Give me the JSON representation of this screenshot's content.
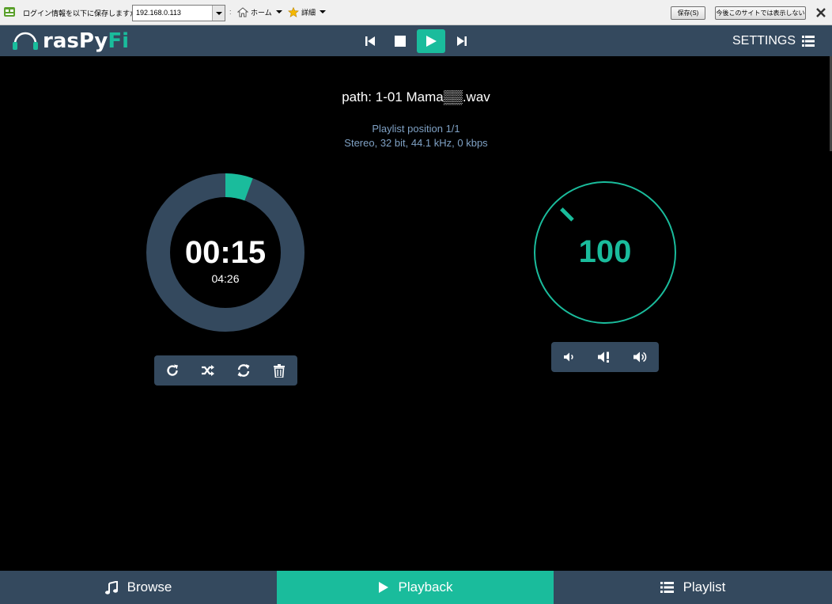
{
  "browser_bar": {
    "prompt": "ログイン情報を以下に保存しますか:",
    "address": "192.168.0.113",
    "separator": ":",
    "home_label": "ホーム",
    "details_label": "詳細",
    "save_button": "保存(S)",
    "never_button": "今後このサイトでは表示しない"
  },
  "header": {
    "logo_text_a": "rasPy",
    "logo_text_b": "Fi",
    "settings_label": "SETTINGS"
  },
  "track": {
    "path": "path: 1-01 Mama▒▒.wav",
    "playlist_position": "Playlist position 1/1",
    "format": "Stereo, 32 bit, 44.1 kHz, 0 kbps"
  },
  "playback": {
    "elapsed": "00:15",
    "total": "04:26",
    "progress_fraction": 0.0564
  },
  "volume": {
    "level": "100",
    "fraction": 1.0
  },
  "tabs": [
    {
      "label": "Browse"
    },
    {
      "label": "Playback"
    },
    {
      "label": "Playlist"
    }
  ],
  "colors": {
    "accent": "#1abc9c",
    "panel": "#34495e",
    "info_text": "#7fa1c4"
  }
}
